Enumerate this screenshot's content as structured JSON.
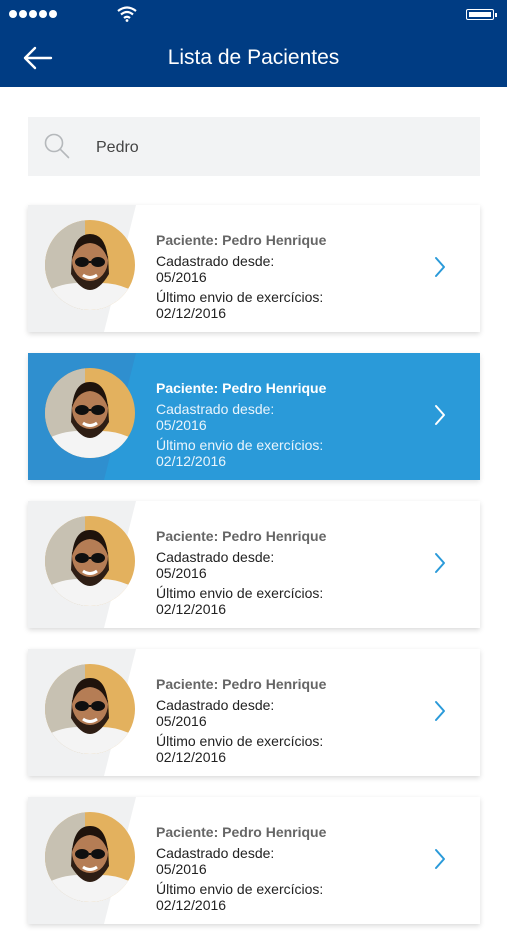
{
  "header": {
    "title": "Lista de Pacientes",
    "back_icon": "arrow-left-icon"
  },
  "search": {
    "value": "Pedro",
    "placeholder": ""
  },
  "colors": {
    "appbar": "#003c83",
    "accent": "#2a9ad9",
    "search_bg": "#f2f3f4"
  },
  "patients": [
    {
      "name": "Paciente: Pedro Henrique",
      "registered_label": "Cadastrado desde:",
      "registered_value": "05/2016",
      "last_label": "Último envio de exercícios:",
      "last_value": "02/12/2016",
      "selected": false
    },
    {
      "name": "Paciente: Pedro Henrique",
      "registered_label": "Cadastrado desde:",
      "registered_value": "05/2016",
      "last_label": "Último envio de exercícios:",
      "last_value": "02/12/2016",
      "selected": true
    },
    {
      "name": "Paciente: Pedro Henrique",
      "registered_label": "Cadastrado desde:",
      "registered_value": "05/2016",
      "last_label": "Último envio de exercícios:",
      "last_value": "02/12/2016",
      "selected": false
    },
    {
      "name": "Paciente: Pedro Henrique",
      "registered_label": "Cadastrado desde:",
      "registered_value": "05/2016",
      "last_label": "Último envio de exercícios:",
      "last_value": "02/12/2016",
      "selected": false
    },
    {
      "name": "Paciente: Pedro Henrique",
      "registered_label": "Cadastrado desde:",
      "registered_value": "05/2016",
      "last_label": "Último envio de exercícios:",
      "last_value": "02/12/2016",
      "selected": false
    }
  ]
}
